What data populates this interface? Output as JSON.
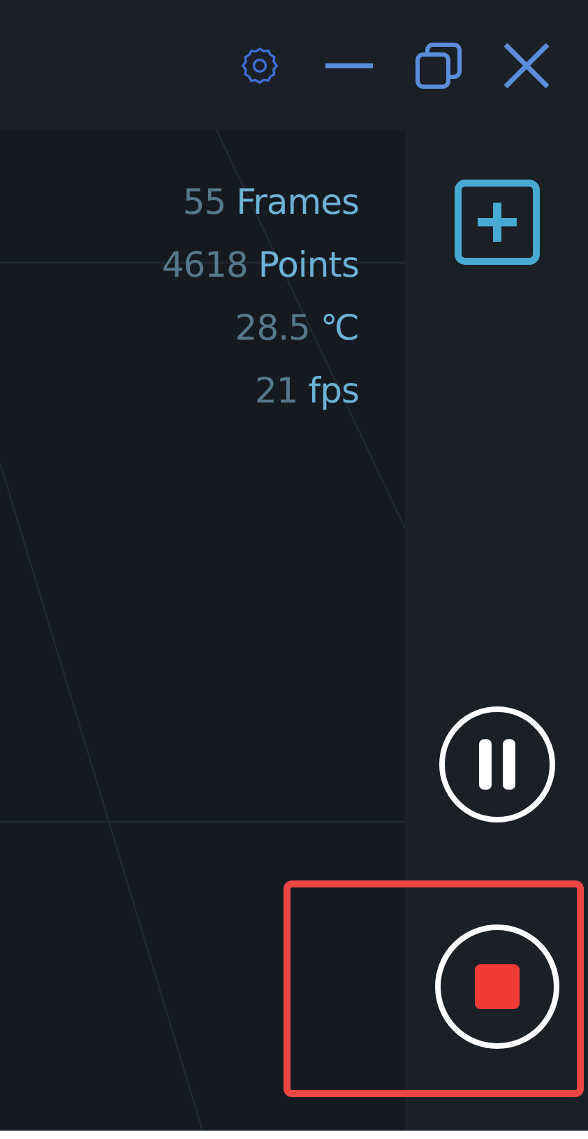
{
  "stats": [
    {
      "value": "55",
      "unit": "Frames"
    },
    {
      "value": "4618",
      "unit": "Points"
    },
    {
      "value": "28.5",
      "unit": "℃"
    },
    {
      "value": "21",
      "unit": "fps"
    }
  ],
  "controls": [
    {
      "kind": "add",
      "highlighted": false
    },
    {
      "kind": "pause",
      "highlighted": false
    },
    {
      "kind": "stop",
      "highlighted": true
    }
  ]
}
